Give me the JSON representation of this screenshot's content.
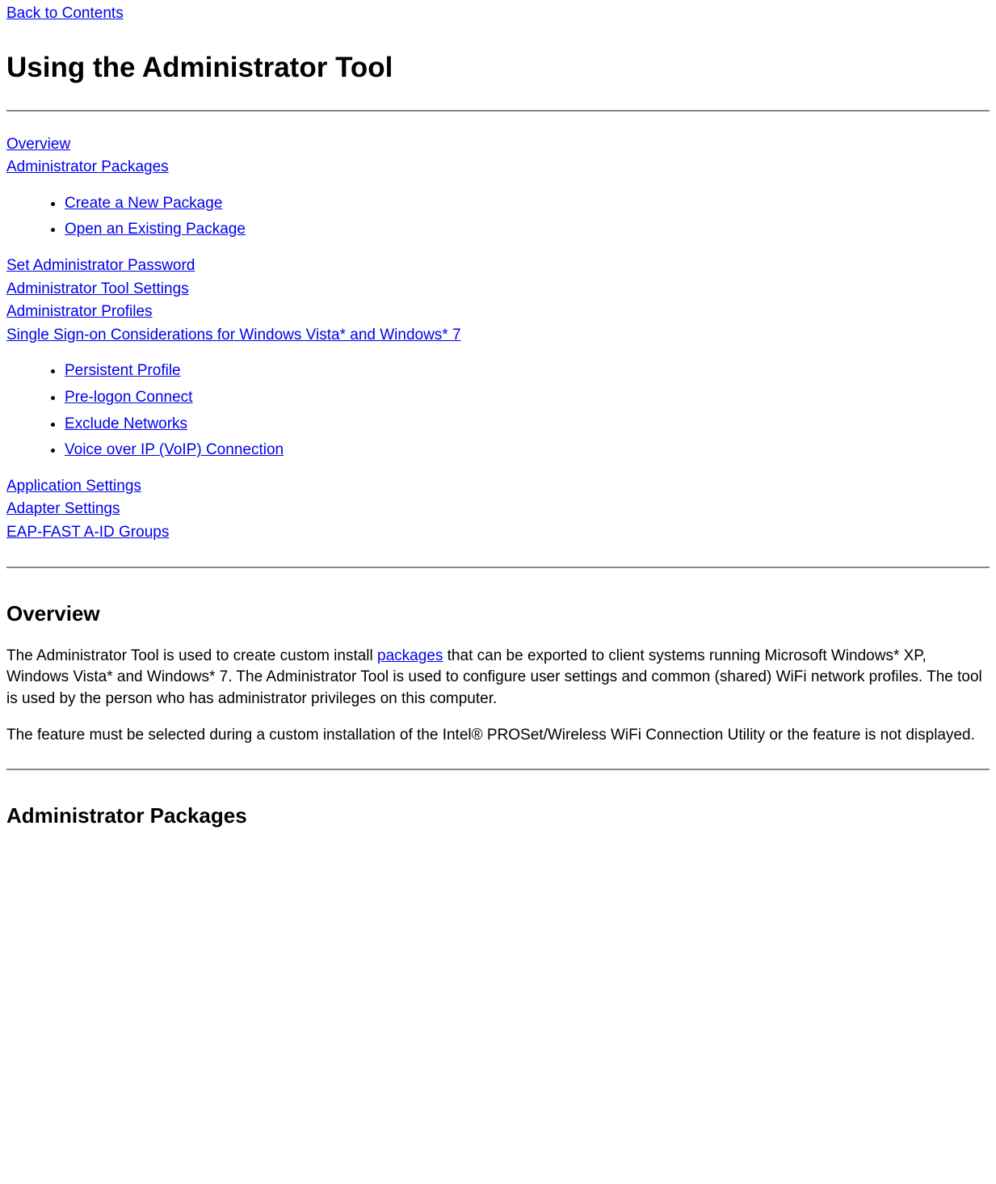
{
  "top_link": "Back to Contents",
  "h1": "Using the Administrator Tool",
  "toc": {
    "overview": "Overview",
    "admin_packages": "Administrator Packages",
    "packages_sub": [
      "Create a New Package",
      "Open an Existing Package"
    ],
    "set_admin_password": "Set Administrator Password",
    "admin_tool_settings": "Administrator Tool Settings",
    "admin_profiles": "Administrator Profiles",
    "single_sign_on": "Single Sign-on Considerations for Windows Vista* and Windows* 7 ",
    "profiles_sub": [
      "Persistent Profile ",
      "Pre-logon Connect",
      "Exclude Networks",
      "Voice over IP (VoIP) Connection"
    ],
    "app_settings": "Application Settings",
    "adapter_settings": "Adapter Settings",
    "eap_fast": "EAP-FAST A-ID Groups"
  },
  "overview_h2": "Overview",
  "overview_p1_pre": "The Administrator Tool is used to create custom install ",
  "overview_p1_link": "packages",
  "overview_p1_post": " that can be exported to client systems running Microsoft Windows* XP, Windows Vista* and Windows* 7. The Administrator Tool is used to configure user settings and common (shared) WiFi network profiles. The tool is used by the person who has administrator privileges on this computer.",
  "overview_p2": "The feature must be selected during a custom installation of the Intel® PROSet/Wireless WiFi Connection Utility or the feature is not displayed.",
  "admin_packages_h2": "Administrator Packages"
}
